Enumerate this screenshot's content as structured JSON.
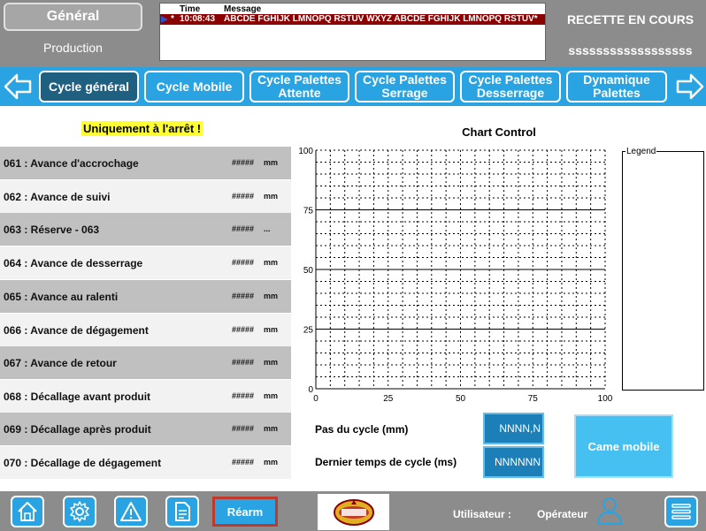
{
  "header": {
    "mode_button": "Général",
    "mode_sub": "Production",
    "messages": {
      "col_time": "Time",
      "col_message": "Message",
      "rows": [
        {
          "marker": "*",
          "time": "10:08:43",
          "message": "ABCDE FGHIJK LMNOPQ RSTUV WXYZ ABCDE FGHIJK LMNOPQ RSTUV*"
        }
      ]
    },
    "recipe_title": "RECETTE EN COURS",
    "recipe_name": "ssssssssssssssssss"
  },
  "tabs": {
    "left_arrow": "arrow-left-icon",
    "right_arrow": "arrow-right-icon",
    "items": [
      {
        "label": "Cycle général",
        "active": true
      },
      {
        "label": "Cycle Mobile",
        "active": false
      },
      {
        "label": "Cycle Palettes Attente",
        "active": false
      },
      {
        "label": "Cycle Palettes Serrage",
        "active": false
      },
      {
        "label": "Cycle Palettes Desserrage",
        "active": false
      },
      {
        "label": "Dynamique Palettes",
        "active": false
      }
    ]
  },
  "warning": "Uniquement à l'arrêt !",
  "params": [
    {
      "label": "061 : Avance d'accrochage",
      "value": "#####",
      "unit": "mm"
    },
    {
      "label": "062 : Avance de suivi",
      "value": "#####",
      "unit": "mm"
    },
    {
      "label": "063 : Réserve - 063",
      "value": "#####",
      "unit": "..."
    },
    {
      "label": "064 : Avance de desserrage",
      "value": "#####",
      "unit": "mm"
    },
    {
      "label": "065 : Avance au ralenti",
      "value": "#####",
      "unit": "mm"
    },
    {
      "label": "066 : Avance de dégagement",
      "value": "#####",
      "unit": "mm"
    },
    {
      "label": "067 : Avance de retour",
      "value": "#####",
      "unit": "mm"
    },
    {
      "label": "068 : Décallage avant produit",
      "value": "#####",
      "unit": "mm"
    },
    {
      "label": "069 : Décallage après produit",
      "value": "#####",
      "unit": "mm"
    },
    {
      "label": "070 : Décallage de dégagement",
      "value": "#####",
      "unit": "mm"
    }
  ],
  "chart": {
    "title": "Chart Control",
    "legend_label": "Legend",
    "x_ticks": [
      "0",
      "25",
      "50",
      "75",
      "100"
    ],
    "y_ticks": [
      "0",
      "25",
      "50",
      "75",
      "100"
    ],
    "xlim": [
      0,
      100
    ],
    "ylim": [
      0,
      100
    ]
  },
  "chart_data": {
    "type": "line",
    "title": "Chart Control",
    "xlabel": "",
    "ylabel": "",
    "xlim": [
      0,
      100
    ],
    "ylim": [
      0,
      100
    ],
    "x_ticks": [
      0,
      25,
      50,
      75,
      100
    ],
    "y_ticks": [
      0,
      25,
      50,
      75,
      100
    ],
    "grid": true,
    "series": [],
    "legend_label": "Legend",
    "legend_position": "right"
  },
  "cycle": {
    "step_label": "Pas du cycle (mm)",
    "step_value": "NNNN,N",
    "time_label": "Dernier temps de cycle (ms)",
    "time_value": "NNNNNN",
    "came_button": "Came mobile"
  },
  "footer": {
    "home_icon": "home-icon",
    "settings_icon": "gear-icon",
    "alarm_icon": "warning-icon",
    "doc_icon": "document-icon",
    "rearm_label": "Réarm",
    "user_label": "Utilisateur :",
    "user_name": "Opérateur",
    "menu_icon": "menu-icon"
  },
  "colors": {
    "accent": "#29a3e1",
    "header_gray": "#8c8c8c",
    "active_tab": "#1f5f7f",
    "alarm_row": "#8b0000",
    "warning_bg": "#ffff33"
  }
}
